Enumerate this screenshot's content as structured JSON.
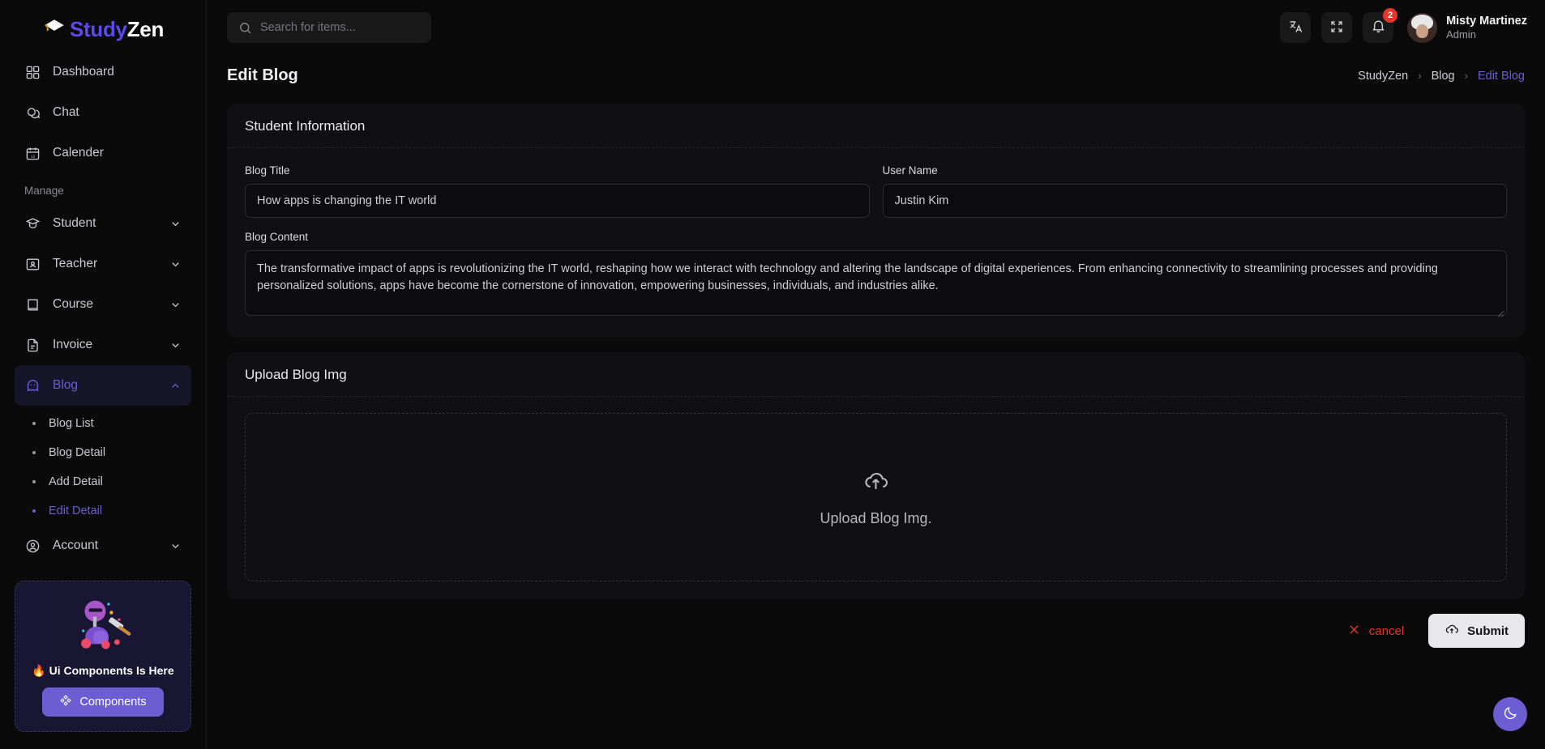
{
  "brand": {
    "part1": "Study",
    "part2": "Zen",
    "cap_icon": "graduation-cap-icon"
  },
  "sidebar": {
    "items": [
      {
        "label": "Dashboard",
        "icon": "dashboard-icon",
        "expandable": false
      },
      {
        "label": "Chat",
        "icon": "chat-icon",
        "expandable": false
      },
      {
        "label": "Calender",
        "icon": "calendar-icon",
        "expandable": false
      }
    ],
    "section_label": "Manage",
    "manage_items": [
      {
        "label": "Student",
        "icon": "student-cap-icon",
        "expandable": true,
        "expanded": false
      },
      {
        "label": "Teacher",
        "icon": "teacher-icon",
        "expandable": true,
        "expanded": false
      },
      {
        "label": "Course",
        "icon": "book-icon",
        "expandable": true,
        "expanded": false
      },
      {
        "label": "Invoice",
        "icon": "document-icon",
        "expandable": true,
        "expanded": false
      },
      {
        "label": "Blog",
        "icon": "ghost-icon",
        "expandable": true,
        "expanded": true,
        "active": true
      }
    ],
    "blog_subitems": [
      {
        "label": "Blog List",
        "active": false
      },
      {
        "label": "Blog Detail",
        "active": false
      },
      {
        "label": "Add Detail",
        "active": false
      },
      {
        "label": "Edit Detail",
        "active": true
      }
    ],
    "account_item": {
      "label": "Account",
      "icon": "user-circle-icon",
      "expandable": true
    },
    "promo": {
      "title": "🔥 Ui Components Is Here",
      "button_label": "Components",
      "button_icon": "components-icon",
      "art_icon": "mining-illustration"
    }
  },
  "topbar": {
    "search": {
      "placeholder": "Search for items...",
      "value": "",
      "icon": "search-icon"
    },
    "translate_icon": "translate-icon",
    "fullscreen_icon": "fullscreen-icon",
    "notification": {
      "icon": "bell-icon",
      "count": "2"
    },
    "user": {
      "name": "Misty Martinez",
      "role": "Admin",
      "avatar": "avatar"
    }
  },
  "page": {
    "title": "Edit Blog",
    "breadcrumb": [
      {
        "label": "StudyZen",
        "current": false
      },
      {
        "label": "Blog",
        "current": false
      },
      {
        "label": "Edit Blog",
        "current": true
      }
    ],
    "separator": "›"
  },
  "student_information": {
    "card_title": "Student Information",
    "blog_title": {
      "label": "Blog Title",
      "value": "How apps is changing the IT world",
      "placeholder": "Blog Title"
    },
    "user_name": {
      "label": "User Name",
      "value": "Justin Kim",
      "placeholder": "User Name"
    },
    "blog_content": {
      "label": "Blog Content",
      "value": "The transformative impact of apps is revolutionizing the IT world, reshaping how we interact with technology and altering the landscape of digital experiences. From enhancing connectivity to streamlining processes and providing personalized solutions, apps have become the cornerstone of innovation, empowering businesses, individuals, and industries alike.",
      "placeholder": "Blog Content"
    }
  },
  "upload_section": {
    "card_title": "Upload Blog Img",
    "dropzone_text": "Upload Blog Img.",
    "dropzone_icon": "cloud-upload-icon"
  },
  "footer_actions": {
    "cancel_label": "cancel",
    "cancel_icon": "close-x-icon",
    "submit_label": "Submit",
    "submit_icon": "cloud-upload-icon"
  },
  "theme_toggle": {
    "icon": "moon-icon"
  },
  "colors": {
    "accent": "#6c5dd3",
    "danger": "#e5352b",
    "page_bg": "#0a0a0a",
    "card_bg": "#101012",
    "input_bg": "#0c0c0e"
  }
}
